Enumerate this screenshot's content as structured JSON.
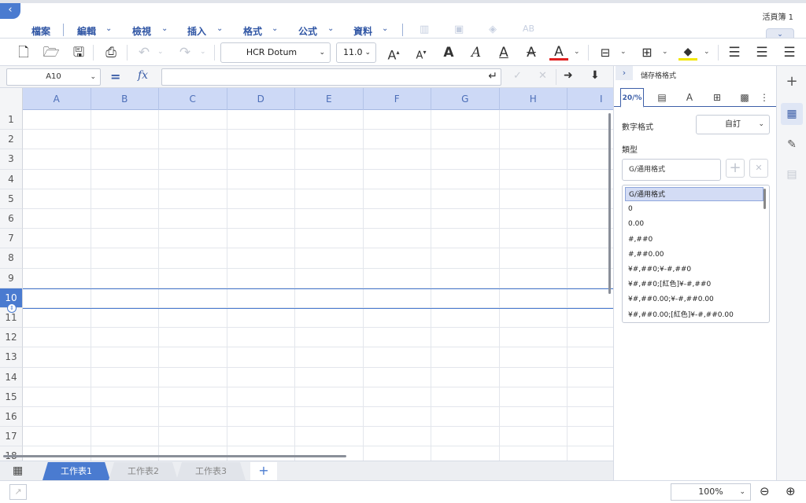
{
  "app": {
    "document_title": "活頁簿 1"
  },
  "menu": [
    {
      "label": "檔案",
      "has_dropdown": false
    },
    {
      "label": "編輯",
      "has_dropdown": true
    },
    {
      "label": "檢視",
      "has_dropdown": true
    },
    {
      "label": "插入",
      "has_dropdown": true
    },
    {
      "label": "格式",
      "has_dropdown": true
    },
    {
      "label": "公式",
      "has_dropdown": true
    },
    {
      "label": "資料",
      "has_dropdown": true
    }
  ],
  "menu_disabled_icons": [
    "chart-icon",
    "image-icon",
    "shapes-icon",
    "text-art-icon"
  ],
  "toolbar": {
    "font_name": "HCR Dotum",
    "font_size": "11.0",
    "font_color_hex": "#e02020",
    "fill_color_hex": "#f2e600"
  },
  "formula_bar": {
    "cell_reference": "A10",
    "equals_symbol": "=",
    "fx_symbol": "fx",
    "formula_value": ""
  },
  "grid": {
    "columns": [
      "A",
      "B",
      "C",
      "D",
      "E",
      "F",
      "G",
      "H",
      "I"
    ],
    "rows": [
      "1",
      "2",
      "3",
      "4",
      "5",
      "6",
      "7",
      "8",
      "9",
      "10",
      "11",
      "12",
      "13",
      "14",
      "15",
      "16",
      "17",
      "18"
    ],
    "selected_row": "10"
  },
  "sheets": {
    "tabs": [
      {
        "label": "工作表1",
        "active": true
      },
      {
        "label": "工作表2",
        "active": false
      },
      {
        "label": "工作表3",
        "active": false
      }
    ],
    "add_label": "+"
  },
  "status": {
    "zoom": "100%"
  },
  "panel": {
    "title": "儲存格格式",
    "active_tab_label": "20/%",
    "number_format_label": "數字格式",
    "number_format_value": "自訂",
    "type_label": "類型",
    "type_value": "G/通用格式",
    "formats": [
      "G/通用格式",
      "0",
      "0.00",
      "#,##0",
      "#,##0.00",
      "¥#,##0;¥-#,##0",
      "¥#,##0;[紅色]¥-#,##0",
      "¥#,##0.00;¥-#,##0.00",
      "¥#,##0.00;[紅色]¥-#,##0.00"
    ],
    "selected_format_index": 0
  },
  "colors": {
    "accent": "#4a7bd0",
    "menu_text": "#2f55a4",
    "column_header_bg": "#cdd9f6"
  }
}
